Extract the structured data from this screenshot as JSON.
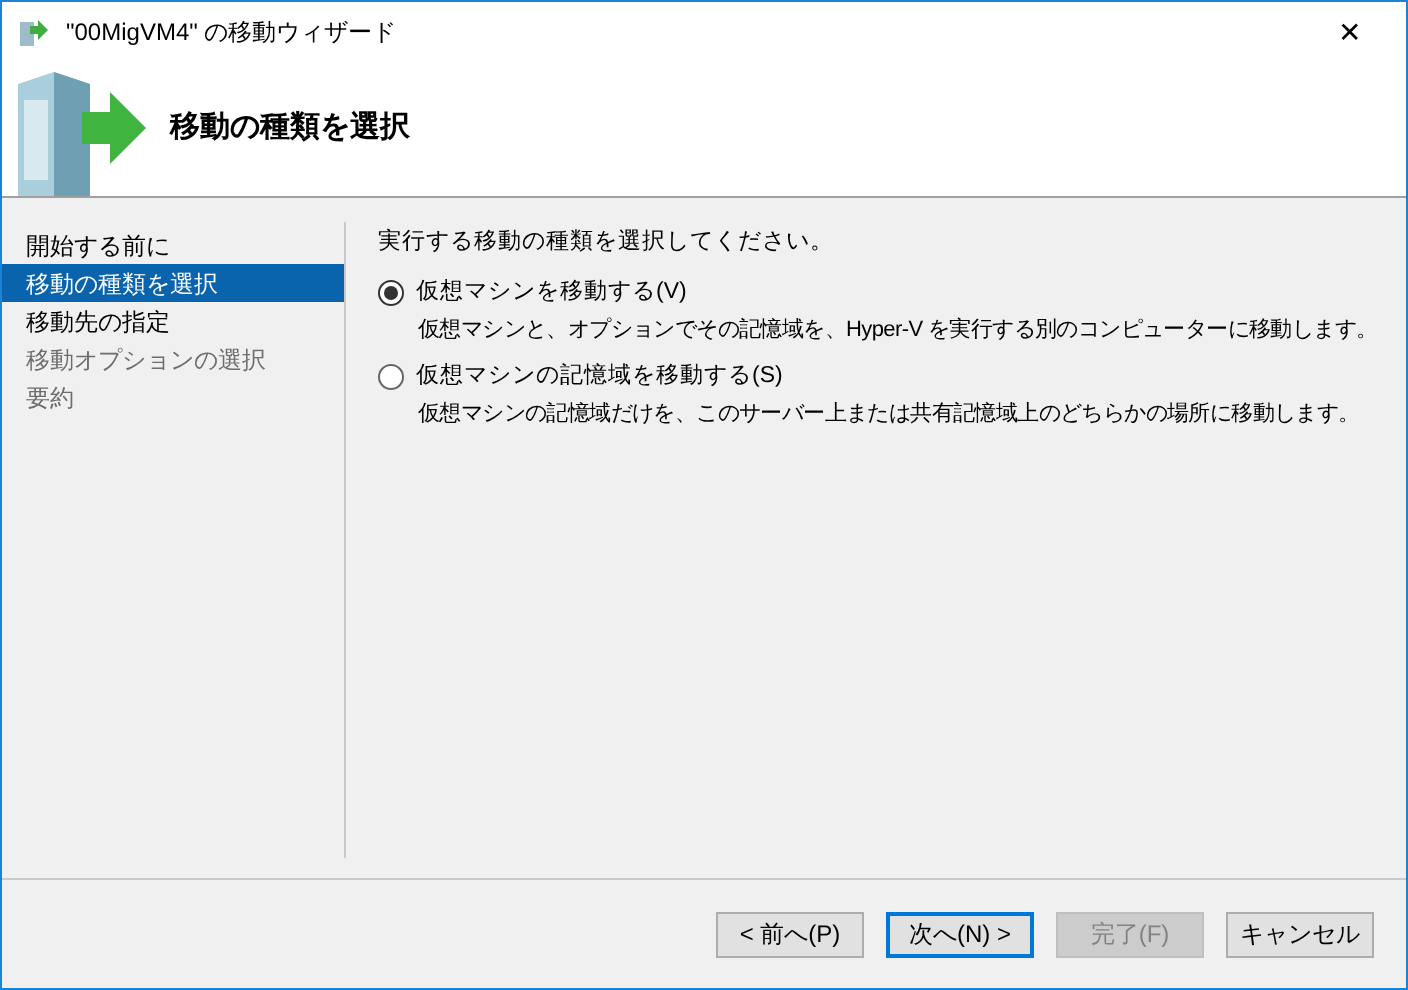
{
  "window": {
    "title": "\"00MigVM4\" の移動ウィザード",
    "close": "✕"
  },
  "header": {
    "title": "移動の種類を選択"
  },
  "sidebar": {
    "items": [
      {
        "label": "開始する前に",
        "selected": false,
        "disabled": false
      },
      {
        "label": "移動の種類を選択",
        "selected": true,
        "disabled": false
      },
      {
        "label": "移動先の指定",
        "selected": false,
        "disabled": false
      },
      {
        "label": "移動オプションの選択",
        "selected": false,
        "disabled": true
      },
      {
        "label": "要約",
        "selected": false,
        "disabled": true
      }
    ]
  },
  "content": {
    "prompt": "実行する移動の種類を選択してください。",
    "options": [
      {
        "label": "仮想マシンを移動する(V)",
        "description": "仮想マシンと、オプションでその記憶域を、Hyper-V を実行する別のコンピューターに移動します。",
        "selected": true
      },
      {
        "label": "仮想マシンの記憶域を移動する(S)",
        "description": "仮想マシンの記憶域だけを、このサーバー上または共有記憶域上のどちらかの場所に移動します。",
        "selected": false
      }
    ]
  },
  "buttons": [
    {
      "label": "< 前へ(P)",
      "default": false,
      "disabled": false
    },
    {
      "label": "次へ(N) >",
      "default": true,
      "disabled": false
    },
    {
      "label": "完了(F)",
      "default": false,
      "disabled": true
    },
    {
      "label": "キャンセル",
      "default": false,
      "disabled": false
    }
  ]
}
